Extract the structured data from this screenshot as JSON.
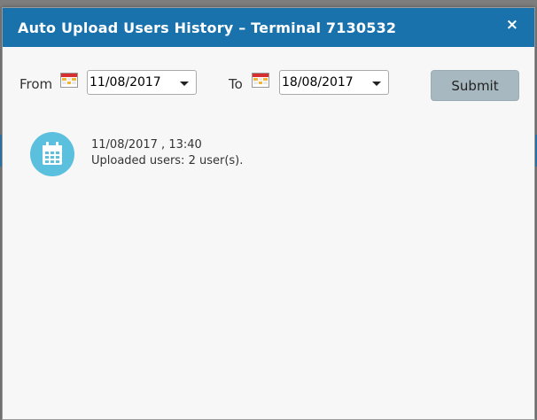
{
  "modal": {
    "title": "Auto Upload Users History – Terminal 7130532",
    "close_label": "×"
  },
  "filters": {
    "from_label": "From",
    "from_value": "11/08/2017",
    "to_label": "To",
    "to_value": "18/08/2017",
    "submit_label": "Submit"
  },
  "history": {
    "items": [
      {
        "datetime": "11/08/2017 , 13:40",
        "summary": "Uploaded users: 2 user(s)."
      }
    ]
  },
  "colors": {
    "header": "#1a72ad",
    "submit_button": "#a8b8c0",
    "calendar_avatar": "#5bc0de"
  }
}
